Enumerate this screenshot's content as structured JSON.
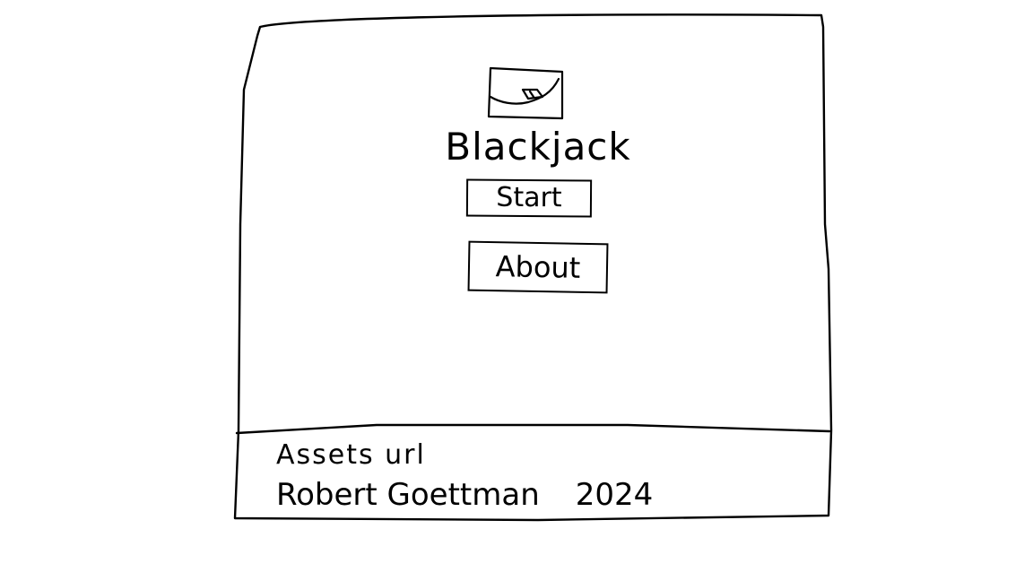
{
  "app": {
    "title": "Blackjack"
  },
  "menu": {
    "start_label": "Start",
    "about_label": "About"
  },
  "footer": {
    "assets_label": "Assets url",
    "author": "Robert Goettman",
    "year": "2024"
  },
  "icons": {
    "logo": "card-logo-icon"
  },
  "colors": {
    "ink": "#000000",
    "background": "#ffffff"
  }
}
